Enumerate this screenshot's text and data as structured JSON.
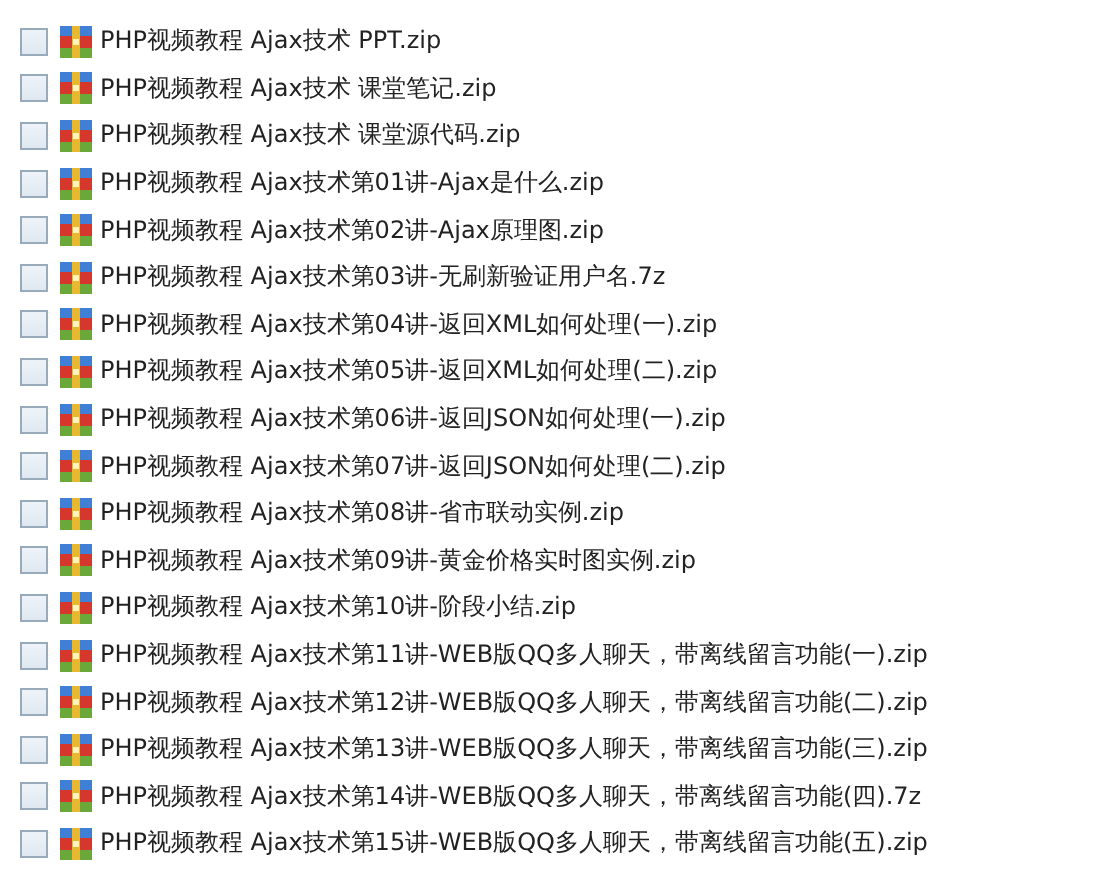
{
  "files": [
    {
      "name": "PHP视频教程 Ajax技术 PPT.zip",
      "checked": false
    },
    {
      "name": "PHP视频教程 Ajax技术 课堂笔记.zip",
      "checked": false
    },
    {
      "name": "PHP视频教程 Ajax技术 课堂源代码.zip",
      "checked": false
    },
    {
      "name": "PHP视频教程 Ajax技术第01讲-Ajax是什么.zip",
      "checked": false
    },
    {
      "name": "PHP视频教程 Ajax技术第02讲-Ajax原理图.zip",
      "checked": false
    },
    {
      "name": "PHP视频教程 Ajax技术第03讲-无刷新验证用户名.7z",
      "checked": false
    },
    {
      "name": "PHP视频教程 Ajax技术第04讲-返回XML如何处理(一).zip",
      "checked": false
    },
    {
      "name": "PHP视频教程 Ajax技术第05讲-返回XML如何处理(二).zip",
      "checked": false
    },
    {
      "name": "PHP视频教程 Ajax技术第06讲-返回JSON如何处理(一).zip",
      "checked": false
    },
    {
      "name": "PHP视频教程 Ajax技术第07讲-返回JSON如何处理(二).zip",
      "checked": false
    },
    {
      "name": "PHP视频教程 Ajax技术第08讲-省市联动实例.zip",
      "checked": false
    },
    {
      "name": "PHP视频教程 Ajax技术第09讲-黄金价格实时图实例.zip",
      "checked": false
    },
    {
      "name": "PHP视频教程 Ajax技术第10讲-阶段小结.zip",
      "checked": false
    },
    {
      "name": "PHP视频教程 Ajax技术第11讲-WEB版QQ多人聊天，带离线留言功能(一).zip",
      "checked": false
    },
    {
      "name": "PHP视频教程 Ajax技术第12讲-WEB版QQ多人聊天，带离线留言功能(二).zip",
      "checked": false
    },
    {
      "name": "PHP视频教程 Ajax技术第13讲-WEB版QQ多人聊天，带离线留言功能(三).zip",
      "checked": false
    },
    {
      "name": "PHP视频教程 Ajax技术第14讲-WEB版QQ多人聊天，带离线留言功能(四).7z",
      "checked": false
    },
    {
      "name": "PHP视频教程 Ajax技术第15讲-WEB版QQ多人聊天，带离线留言功能(五).zip",
      "checked": false
    }
  ]
}
